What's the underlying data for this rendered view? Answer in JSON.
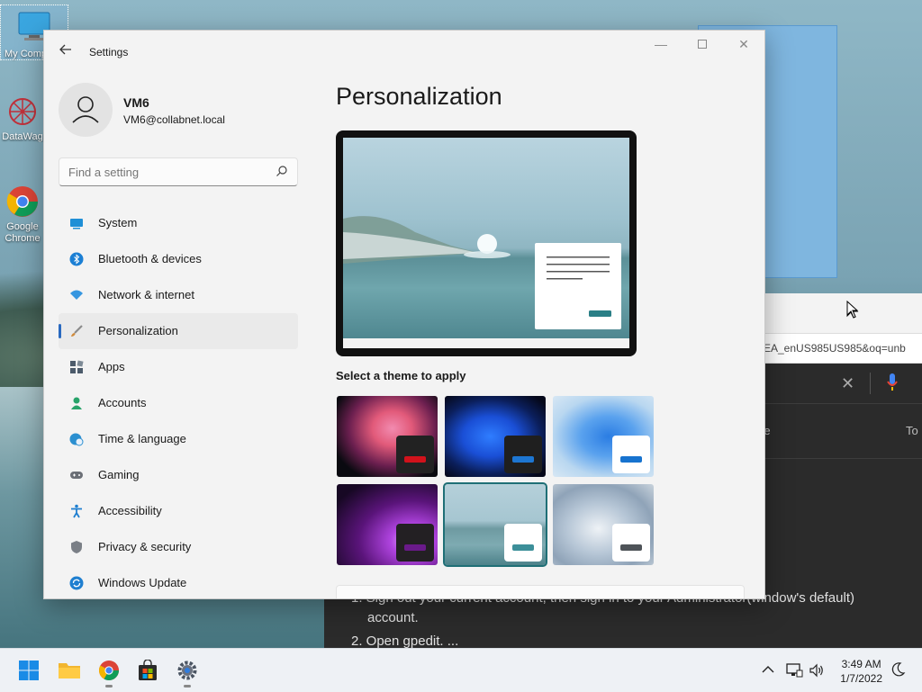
{
  "desktop": {
    "icons": [
      {
        "label": "My Computer",
        "icon": "monitor-icon"
      },
      {
        "label": "DataWag",
        "icon": "datawag-icon"
      },
      {
        "label": "Google Chrome",
        "icon": "chrome-icon"
      }
    ]
  },
  "background_browser": {
    "address_fragment": "EA_enUS985US985&oq=unb",
    "tab_label_1": "re",
    "tab_label_2": "To",
    "result_line_1": "1. Sign out your current account, then sign in to your Administrator(window's default)",
    "result_line_1b": "account.",
    "result_line_2": "2. Open gpedit. ..."
  },
  "settings": {
    "window_title": "Settings",
    "user": {
      "name": "VM6",
      "email": "VM6@collabnet.local"
    },
    "search": {
      "placeholder": "Find a setting"
    },
    "nav": [
      {
        "label": "System",
        "icon": "system-icon",
        "color": "#1f8fd6"
      },
      {
        "label": "Bluetooth & devices",
        "icon": "bluetooth-icon",
        "color": "#1b7fd4"
      },
      {
        "label": "Network & internet",
        "icon": "wifi-icon",
        "color": "#3596e0"
      },
      {
        "label": "Personalization",
        "icon": "brush-icon",
        "color": "#d08a3a",
        "selected": true
      },
      {
        "label": "Apps",
        "icon": "apps-icon",
        "color": "#4c5b6b"
      },
      {
        "label": "Accounts",
        "icon": "accounts-icon",
        "color": "#28a36a"
      },
      {
        "label": "Time & language",
        "icon": "globe-clock-icon",
        "color": "#2b8fd0"
      },
      {
        "label": "Gaming",
        "icon": "gamepad-icon",
        "color": "#6b6f76"
      },
      {
        "label": "Accessibility",
        "icon": "accessibility-icon",
        "color": "#1f7fd0"
      },
      {
        "label": "Privacy & security",
        "icon": "shield-icon",
        "color": "#7a7f86"
      },
      {
        "label": "Windows Update",
        "icon": "update-icon",
        "color": "#1f7fd0"
      }
    ],
    "content": {
      "title": "Personalization",
      "themes_heading": "Select a theme to apply"
    }
  },
  "taskbar": {
    "time": "3:49 AM",
    "date": "1/7/2022"
  },
  "colors": {
    "accent": "#2a6ac0",
    "selected_theme_outline": "#1f6f76"
  }
}
